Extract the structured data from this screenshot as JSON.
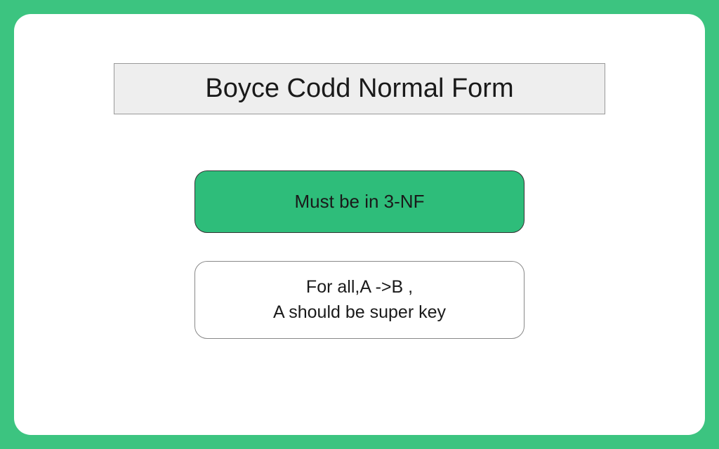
{
  "title": "Boyce Codd Normal Form",
  "conditions": {
    "primary": "Must be in 3-NF",
    "secondary_line1": "For all,A ->B ,",
    "secondary_line2": "A should be super key"
  },
  "colors": {
    "accent": "#3cc480",
    "primaryFill": "#2ebd7a"
  }
}
